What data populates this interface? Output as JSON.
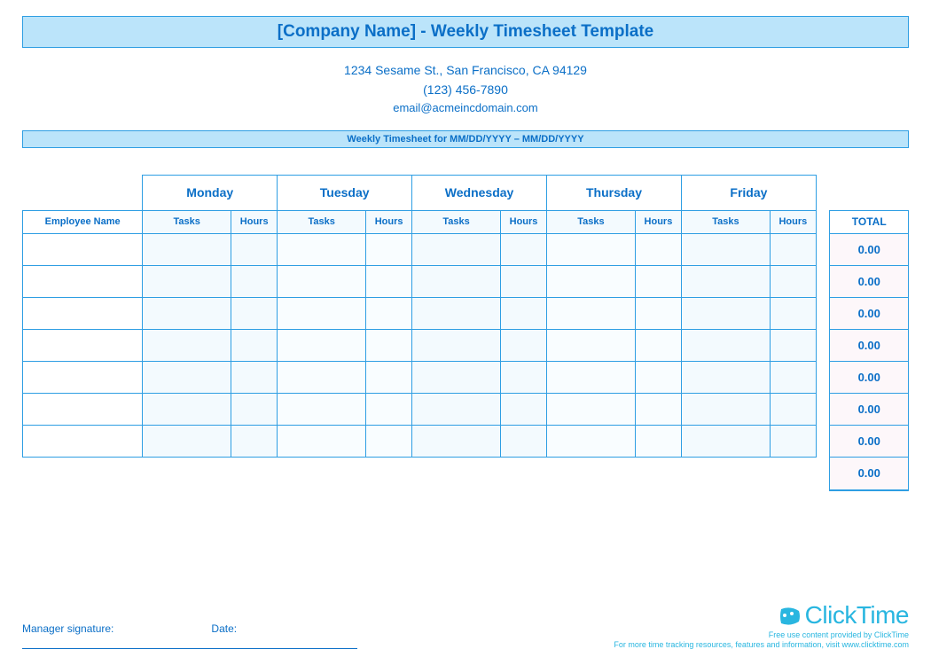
{
  "header": {
    "title": "[Company Name] - Weekly Timesheet Template",
    "address": "1234 Sesame St.,  San Francisco, CA 94129",
    "phone": "(123) 456-7890",
    "email": "email@acmeincdomain.com",
    "date_range": "Weekly Timesheet for MM/DD/YYYY – MM/DD/YYYY"
  },
  "columns": {
    "employee": "Employee Name",
    "tasks": "Tasks",
    "hours": "Hours",
    "total": "TOTAL"
  },
  "days": [
    "Monday",
    "Tuesday",
    "Wednesday",
    "Thursday",
    "Friday"
  ],
  "rows": [
    {
      "employee": "",
      "mon_t": "",
      "mon_h": "",
      "tue_t": "",
      "tue_h": "",
      "wed_t": "",
      "wed_h": "",
      "thu_t": "",
      "thu_h": "",
      "fri_t": "",
      "fri_h": "",
      "total": "0.00"
    },
    {
      "employee": "",
      "mon_t": "",
      "mon_h": "",
      "tue_t": "",
      "tue_h": "",
      "wed_t": "",
      "wed_h": "",
      "thu_t": "",
      "thu_h": "",
      "fri_t": "",
      "fri_h": "",
      "total": "0.00"
    },
    {
      "employee": "",
      "mon_t": "",
      "mon_h": "",
      "tue_t": "",
      "tue_h": "",
      "wed_t": "",
      "wed_h": "",
      "thu_t": "",
      "thu_h": "",
      "fri_t": "",
      "fri_h": "",
      "total": "0.00"
    },
    {
      "employee": "",
      "mon_t": "",
      "mon_h": "",
      "tue_t": "",
      "tue_h": "",
      "wed_t": "",
      "wed_h": "",
      "thu_t": "",
      "thu_h": "",
      "fri_t": "",
      "fri_h": "",
      "total": "0.00"
    },
    {
      "employee": "",
      "mon_t": "",
      "mon_h": "",
      "tue_t": "",
      "tue_h": "",
      "wed_t": "",
      "wed_h": "",
      "thu_t": "",
      "thu_h": "",
      "fri_t": "",
      "fri_h": "",
      "total": "0.00"
    },
    {
      "employee": "",
      "mon_t": "",
      "mon_h": "",
      "tue_t": "",
      "tue_h": "",
      "wed_t": "",
      "wed_h": "",
      "thu_t": "",
      "thu_h": "",
      "fri_t": "",
      "fri_h": "",
      "total": "0.00"
    },
    {
      "employee": "",
      "mon_t": "",
      "mon_h": "",
      "tue_t": "",
      "tue_h": "",
      "wed_t": "",
      "wed_h": "",
      "thu_t": "",
      "thu_h": "",
      "fri_t": "",
      "fri_h": "",
      "total": "0.00"
    }
  ],
  "grand_total": "0.00",
  "footer": {
    "signature_label": "Manager signature:",
    "date_label": "Date:",
    "brand_name": "ClickTime",
    "brand_tagline": "Free use content provided by ClickTime",
    "brand_note": "For more time tracking resources, features and information, visit www.clicktime.com"
  }
}
